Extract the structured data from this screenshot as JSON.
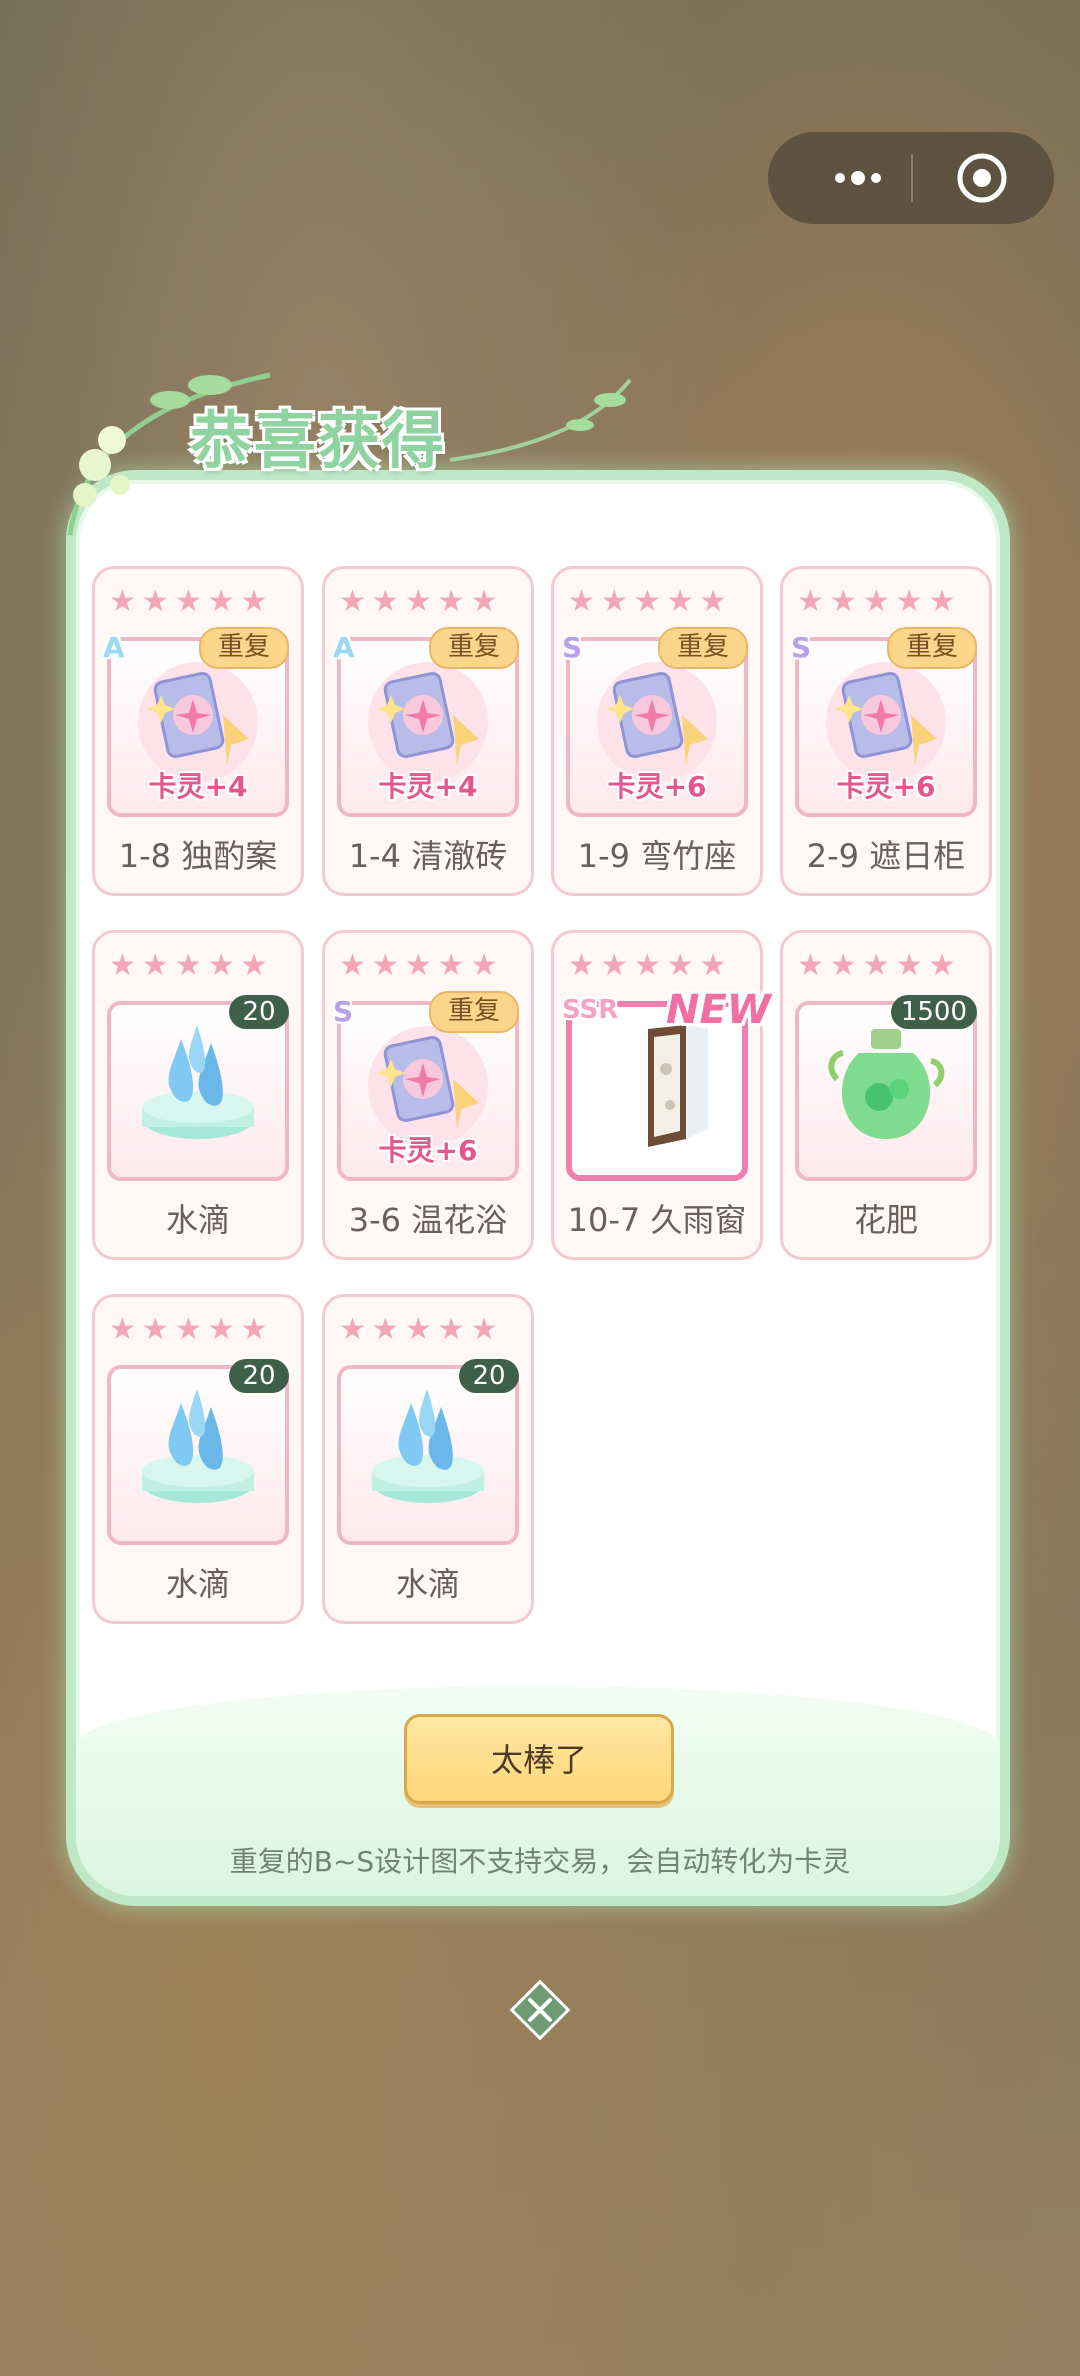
{
  "header": {
    "title": "恭喜获得"
  },
  "capsule": {
    "more_icon": "more-dots-icon",
    "close_icon": "target-circle-icon"
  },
  "items": [
    {
      "name": "1-8 独酌案",
      "grade": "A",
      "tag": "重复",
      "spirit": "卡灵+4",
      "icon": "card-spirit-icon"
    },
    {
      "name": "1-4 清澈砖",
      "grade": "A",
      "tag": "重复",
      "spirit": "卡灵+4",
      "icon": "card-spirit-icon"
    },
    {
      "name": "1-9 弯竹座",
      "grade": "S",
      "tag": "重复",
      "spirit": "卡灵+6",
      "icon": "card-spirit-icon"
    },
    {
      "name": "2-9 遮日柜",
      "grade": "S",
      "tag": "重复",
      "spirit": "卡灵+6",
      "icon": "card-spirit-icon"
    },
    {
      "name": "水滴",
      "count": "20",
      "icon": "water-drop-icon"
    },
    {
      "name": "3-6 温花浴",
      "grade": "S",
      "tag": "重复",
      "spirit": "卡灵+6",
      "icon": "card-spirit-icon"
    },
    {
      "name": "10-7 久雨窗",
      "grade": "SSR",
      "new": "NEW",
      "icon": "window-icon"
    },
    {
      "name": "花肥",
      "count": "1500",
      "icon": "fertilizer-jar-icon"
    },
    {
      "name": "水滴",
      "count": "20",
      "icon": "water-drop-icon"
    },
    {
      "name": "水滴",
      "count": "20",
      "icon": "water-drop-icon"
    }
  ],
  "stars": "★",
  "button": {
    "label": "太棒了"
  },
  "note": "重复的B~S设计图不支持交易，会自动转化为卡灵",
  "colors": {
    "panel_border": "#bfe8c6",
    "title": "#8ed3a0",
    "button": "#ffd679",
    "spirit_text": "#e2588e"
  }
}
